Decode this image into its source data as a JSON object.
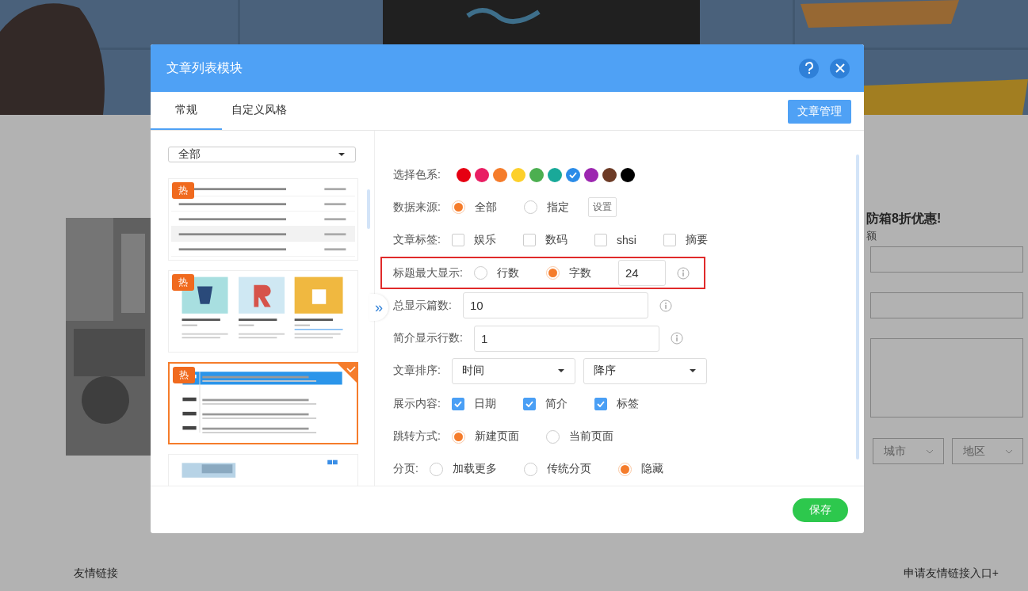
{
  "background_page": {
    "promo_heading": "防箱8折优惠!",
    "field_label": "额",
    "selects": [
      "城市",
      "地区"
    ],
    "footer_left": "友情链接",
    "footer_right": "申请友情链接入口+"
  },
  "dialog": {
    "title": "文章列表模块",
    "tabs": [
      {
        "label": "常规",
        "selected": true
      },
      {
        "label": "自定义风格",
        "selected": false
      }
    ],
    "manage_button": "文章管理",
    "category_select": "全部",
    "templates": [
      {
        "kind": "list",
        "badge": "热",
        "selected": false
      },
      {
        "kind": "gallery",
        "badge": "热",
        "selected": false
      },
      {
        "kind": "timeline",
        "badge": "热",
        "selected": true
      },
      {
        "kind": "banner",
        "selected": false
      }
    ],
    "collapse_button": "»",
    "form": [
      {
        "kind": "colors",
        "label": "选择色系:",
        "colors": [
          {
            "color": "#e60012",
            "selected": false
          },
          {
            "color": "#e91e63",
            "selected": false
          },
          {
            "color": "#f57c2b",
            "selected": false
          },
          {
            "color": "#fdd02b",
            "selected": false
          },
          {
            "color": "#4caf50",
            "selected": false
          },
          {
            "color": "#19a999",
            "selected": false
          },
          {
            "color": "#2b8ce8",
            "selected": true
          },
          {
            "color": "#9c27b0",
            "selected": false
          },
          {
            "color": "#6d3b26",
            "selected": false
          },
          {
            "color": "#000000",
            "selected": false
          }
        ]
      },
      {
        "kind": "radio",
        "label": "数据来源:",
        "options": [
          {
            "label": "全部",
            "selected": true
          },
          {
            "label": "指定",
            "selected": false
          }
        ],
        "button": "设置"
      },
      {
        "kind": "checkbox",
        "label": "文章标签:",
        "options": [
          {
            "label": "娱乐",
            "checked": false
          },
          {
            "label": "数码",
            "checked": false
          },
          {
            "label": "shsi",
            "checked": false
          },
          {
            "label": "摘要",
            "checked": false
          }
        ]
      },
      {
        "kind": "radio",
        "label": "标题最大显示:",
        "highlighted": true,
        "options": [
          {
            "label": "行数",
            "selected": false
          },
          {
            "label": "字数",
            "selected": true
          }
        ],
        "input": "24"
      },
      {
        "kind": "input",
        "label": "总显示篇数:",
        "value": "10"
      },
      {
        "kind": "input",
        "label": "简介显示行数:",
        "value": "1"
      },
      {
        "kind": "selects",
        "label": "文章排序:",
        "selects": [
          "时间",
          "降序"
        ]
      },
      {
        "kind": "checkbox",
        "label": "展示内容:",
        "options": [
          {
            "label": "日期",
            "checked": true
          },
          {
            "label": "简介",
            "checked": true
          },
          {
            "label": "标签",
            "checked": true
          }
        ]
      },
      {
        "kind": "radio",
        "label": "跳转方式:",
        "options": [
          {
            "label": "新建页面",
            "selected": true
          },
          {
            "label": "当前页面",
            "selected": false
          }
        ]
      },
      {
        "kind": "radio",
        "label": "分页:",
        "options": [
          {
            "label": "加载更多",
            "selected": false
          },
          {
            "label": "传统分页",
            "selected": false
          },
          {
            "label": "隐藏",
            "selected": true
          }
        ]
      }
    ],
    "save_button": "保存"
  }
}
